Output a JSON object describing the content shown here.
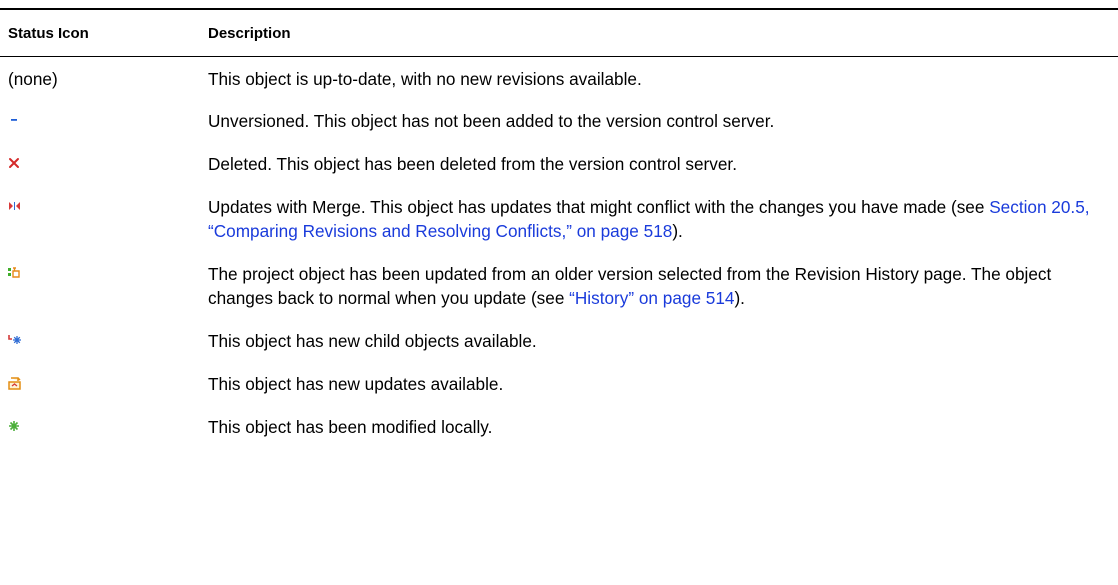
{
  "table": {
    "headers": {
      "status_icon": "Status Icon",
      "description": "Description"
    },
    "rows": [
      {
        "icon_name": "none-text",
        "icon_text": "(none)",
        "description": "This object is up-to-date, with no new revisions available."
      },
      {
        "icon_name": "unversioned-dash-icon",
        "description": "Unversioned. This object has not been added to the version control server."
      },
      {
        "icon_name": "deleted-x-icon",
        "description": "Deleted. This object has been deleted from the version control server."
      },
      {
        "icon_name": "merge-arrows-icon",
        "description_before": "Updates with Merge. This object has updates that might conflict with the changes you have made (see ",
        "link": "Section 20.5, “Comparing Revisions and Resolving Conflicts,” on page 518",
        "description_after": ")."
      },
      {
        "icon_name": "reverted-history-icon",
        "description_before": "The project object has been updated from an older version selected from the Revision History page. The object changes back to normal when you update (see ",
        "link": "“History” on page 514",
        "description_after": ")."
      },
      {
        "icon_name": "new-children-icon",
        "description": "This object has new child objects available."
      },
      {
        "icon_name": "new-updates-icon",
        "description": "This object has new updates available."
      },
      {
        "icon_name": "modified-locally-icon",
        "description": "This object has been modified locally."
      }
    ]
  },
  "colors": {
    "link": "#1a3bdb",
    "unversioned": "#1f5fd6",
    "deleted": "#d42a2a",
    "merge": "#d83a3a",
    "reverted_green": "#3fae2a",
    "reverted_orange": "#e78a1a",
    "new_children_red": "#d43a3a",
    "new_children_blue": "#2d6bd4",
    "updates": "#e38e14",
    "modified": "#4caf3a"
  }
}
